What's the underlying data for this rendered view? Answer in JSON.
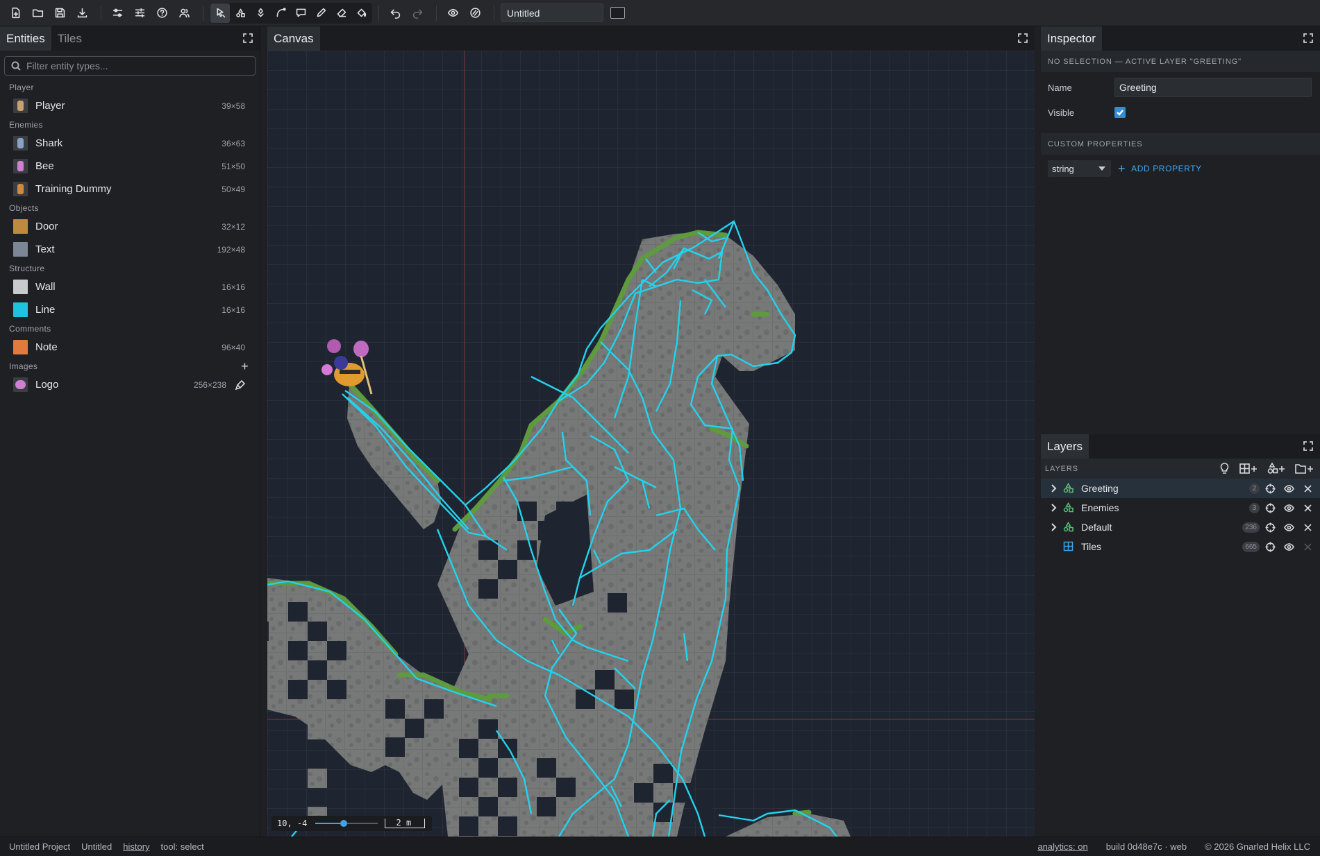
{
  "toolbar": {
    "file_icons": [
      "new-file-icon",
      "open-folder-icon",
      "save-icon",
      "download-icon"
    ],
    "settings_icons": [
      "sliders-icon",
      "tune-icon",
      "help-icon",
      "users-icon"
    ],
    "tools": [
      "select",
      "entity",
      "paint",
      "curve",
      "comment",
      "pencil",
      "eraser",
      "fill"
    ],
    "active_tool": "select",
    "document_title": "Untitled"
  },
  "left_panel": {
    "tabs": [
      {
        "label": "Entities",
        "active": true
      },
      {
        "label": "Tiles",
        "active": false
      }
    ],
    "filter_placeholder": "Filter entity types...",
    "categories": [
      {
        "name": "Player",
        "items": [
          {
            "label": "Player",
            "size": "39×58",
            "thumb": "player-sprite",
            "color": "#3a3d42"
          }
        ]
      },
      {
        "name": "Enemies",
        "items": [
          {
            "label": "Shark",
            "size": "36×63",
            "thumb": "shark-sprite",
            "color": "#3a3d42"
          },
          {
            "label": "Bee",
            "size": "51×50",
            "thumb": "bee-sprite",
            "color": "#3a3d42"
          },
          {
            "label": "Training Dummy",
            "size": "50×49",
            "thumb": "dummy-sprite",
            "color": "#3a3d42"
          }
        ]
      },
      {
        "name": "Objects",
        "items": [
          {
            "label": "Door",
            "size": "32×12",
            "thumb": "swatch",
            "color": "#c08a3e"
          },
          {
            "label": "Text",
            "size": "192×48",
            "thumb": "swatch",
            "color": "#7b8797"
          }
        ]
      },
      {
        "name": "Structure",
        "items": [
          {
            "label": "Wall",
            "size": "16×16",
            "thumb": "swatch",
            "color": "#c9cacc"
          },
          {
            "label": "Line",
            "size": "16×16",
            "thumb": "swatch",
            "color": "#1ec3e0"
          }
        ]
      },
      {
        "name": "Comments",
        "items": [
          {
            "label": "Note",
            "size": "96×40",
            "thumb": "swatch",
            "color": "#e07a3e"
          }
        ]
      }
    ],
    "images_category": "Images",
    "images": [
      {
        "label": "Logo",
        "size": "256×238"
      }
    ]
  },
  "canvas": {
    "tab_label": "Canvas",
    "coords": "10, -4",
    "zoom_fraction": 0.45,
    "scale_label": "2 m",
    "line_color": "#22d3ee"
  },
  "inspector": {
    "tab_label": "Inspector",
    "selection_header": "NO SELECTION — ACTIVE LAYER \"GREETING\"",
    "name_label": "Name",
    "name_value": "Greeting",
    "visible_label": "Visible",
    "visible_checked": true,
    "custom_header": "CUSTOM PROPERTIES",
    "type_select": "string",
    "add_property": "ADD PROPERTY"
  },
  "layers": {
    "tab_label": "Layers",
    "header": "LAYERS",
    "items": [
      {
        "name": "Greeting",
        "count": "2",
        "type": "entity",
        "active": true,
        "expandable": true
      },
      {
        "name": "Enemies",
        "count": "3",
        "type": "entity",
        "active": false,
        "expandable": true
      },
      {
        "name": "Default",
        "count": "236",
        "type": "entity",
        "active": false,
        "expandable": true
      },
      {
        "name": "Tiles",
        "count": "665",
        "type": "tiles",
        "active": false,
        "expandable": false
      }
    ]
  },
  "status": {
    "project": "Untitled Project",
    "document": "Untitled",
    "history": "history",
    "tool": "tool: select",
    "analytics": "analytics: on",
    "build": "build 0d48e7c · web",
    "copyright": "© 2026 Gnarled Helix LLC"
  }
}
